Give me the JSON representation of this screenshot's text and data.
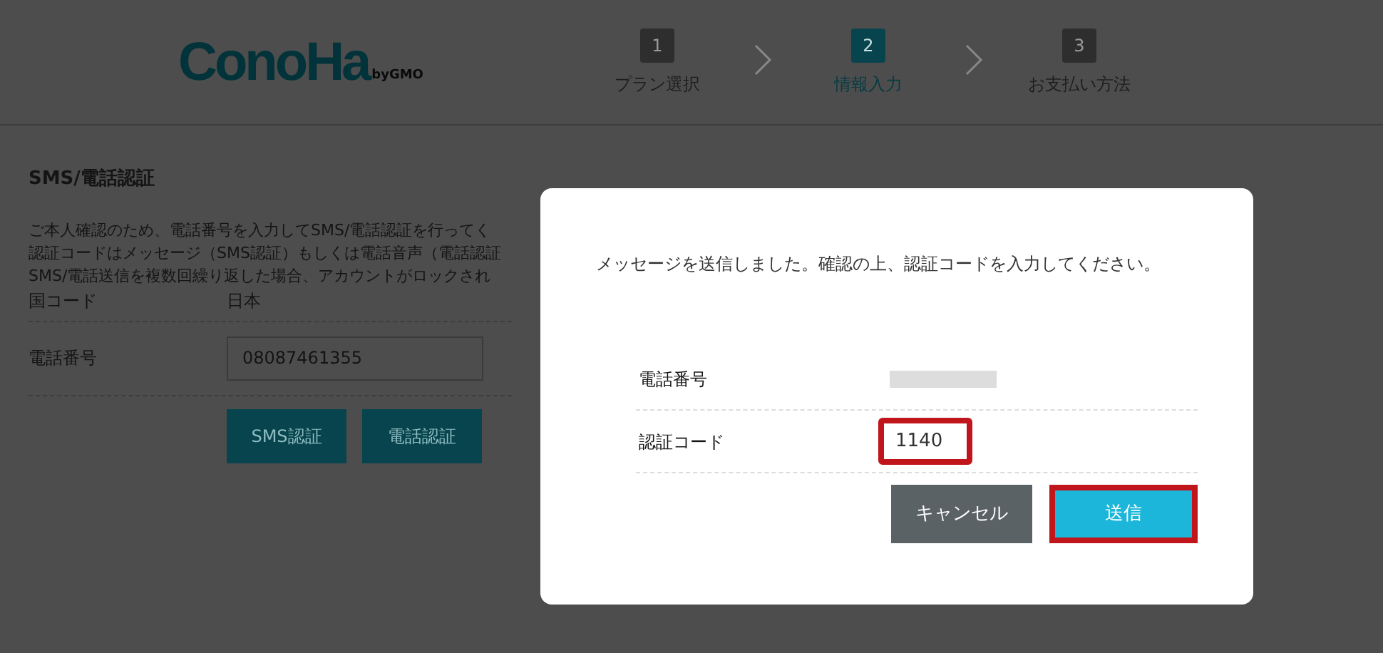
{
  "header": {
    "logo": {
      "name": "ConoHa",
      "byline": "byGMO"
    },
    "steps": [
      {
        "number": "1",
        "label": "プラン選択",
        "selected": false
      },
      {
        "number": "2",
        "label": "情報入力",
        "selected": true
      },
      {
        "number": "3",
        "label": "お支払い方法",
        "selected": false
      }
    ]
  },
  "section": {
    "title": "SMS/電話認証",
    "description": [
      "ご本人確認のため、電話番号を入力してSMS/電話認証を行ってく",
      "認証コードはメッセージ（SMS認証）もしくは電話音声（電話認証",
      "SMS/電話送信を複数回繰り返した場合、アカウントがロックされ"
    ],
    "country": {
      "label": "国コード",
      "value": "日本"
    },
    "phone": {
      "label": "電話番号",
      "value": "08087461355"
    },
    "buttons": [
      "SMS認証",
      "電話認証"
    ]
  },
  "modal": {
    "message": "メッセージを送信しました。確認の上、認証コードを入力してください。",
    "rows": [
      {
        "kind": "redacted",
        "label": "電話番号"
      },
      {
        "kind": "input",
        "label": "認証コード",
        "value": "1140",
        "highlighted": true
      }
    ],
    "buttons": [
      {
        "kind": "secondary",
        "label": "キャンセル",
        "highlighted": false
      },
      {
        "kind": "primary",
        "label": "送信",
        "highlighted": true
      }
    ]
  }
}
